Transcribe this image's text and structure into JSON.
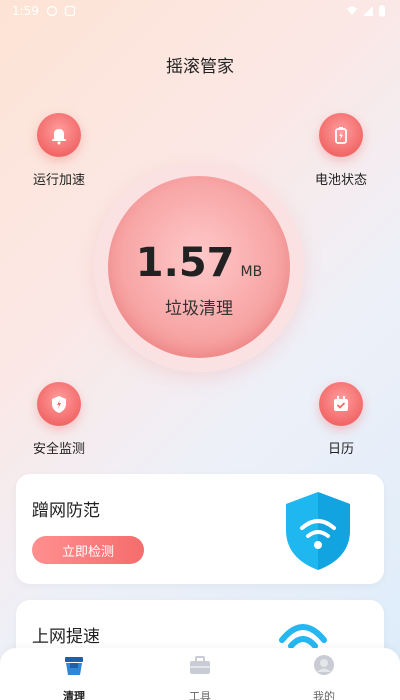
{
  "status": {
    "time": "1:59"
  },
  "app": {
    "title": "摇滚管家"
  },
  "features": {
    "run_speed": "运行加速",
    "battery": "电池状态",
    "security": "安全监测",
    "calendar": "日历"
  },
  "cleaner": {
    "size": "1.57",
    "unit": "MB",
    "label": "垃圾清理"
  },
  "cards": {
    "wifi_guard": {
      "title": "蹭网防范",
      "button": "立即检测"
    },
    "net_speed": {
      "title": "上网提速"
    }
  },
  "tabs": [
    {
      "label": "清理"
    },
    {
      "label": "工具"
    },
    {
      "label": "我的"
    }
  ],
  "colors": {
    "accent": "#f26868",
    "shield": "#1fb7f0"
  },
  "icons": [
    "bell-icon",
    "battery-icon",
    "shield-icon",
    "calendar-icon",
    "wifi-icon",
    "broom-icon",
    "toolbox-icon",
    "person-icon"
  ]
}
